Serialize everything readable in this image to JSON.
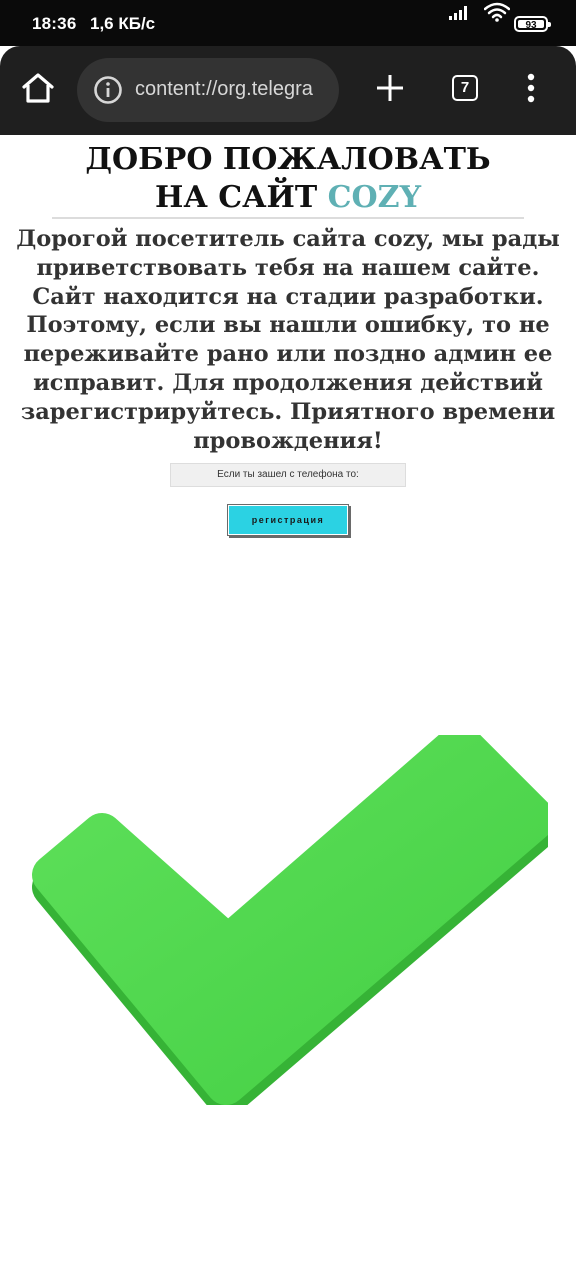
{
  "status_bar": {
    "time": "18:36",
    "speed": "1,6 КБ/с",
    "battery": "93",
    "icons": [
      "signal-icon",
      "wifi-icon",
      "battery-icon"
    ]
  },
  "browser": {
    "url": "content://org.telegra",
    "tab_count": "7",
    "icons": [
      "home-icon",
      "info-icon",
      "plus-icon",
      "tabs-icon",
      "more-vert-icon"
    ]
  },
  "page": {
    "title_line1": "ДОБРО ПОЖАЛОВАТЬ",
    "title_line2_prefix": "НА САЙТ",
    "title_brand": "COZY",
    "welcome_text": "Дорогой посетитель сайта cozy, мы рады приветствовать тебя на нашем сайте. Сайт находится на стадии разработки. Поэтому, если вы нашли ошибку, то не переживайте рано или поздно админ ее исправит. Для продолжения действий зарегистрируйтесь. Приятного времени провождения!",
    "phone_note": "Если ты зашел с телефона то:",
    "register_label": "регистрация",
    "image": "green-checkmark"
  },
  "colors": {
    "status_bar": "#0a0a0a",
    "toolbar": "#1f1f1f",
    "url_pill": "#333333",
    "brand": "#5fb0b4",
    "button": "#2bd2e3",
    "checkmark": "#4cd94c"
  }
}
